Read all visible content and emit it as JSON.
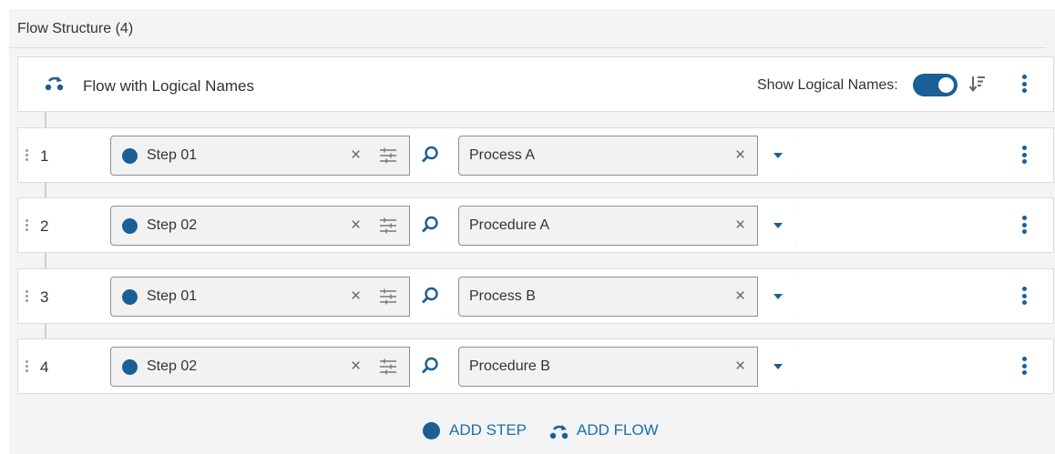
{
  "header": {
    "title": "Flow Structure (4)"
  },
  "flow": {
    "name": "Flow with Logical Names",
    "show_logical_names_label": "Show Logical Names:",
    "show_logical_names": true,
    "icon": "flow-icon"
  },
  "rows": [
    {
      "number": "1",
      "step": "Step 01",
      "process": "Process A"
    },
    {
      "number": "2",
      "step": "Step 02",
      "process": "Procedure A"
    },
    {
      "number": "3",
      "step": "Step 01",
      "process": "Process B"
    },
    {
      "number": "4",
      "step": "Step 02",
      "process": "Procedure B"
    }
  ],
  "icons": {
    "clear": "×"
  },
  "footer": {
    "add_step": "ADD STEP",
    "add_flow": "ADD FLOW"
  },
  "colors": {
    "accent": "#1a5f96",
    "link": "#1a6fb0"
  }
}
